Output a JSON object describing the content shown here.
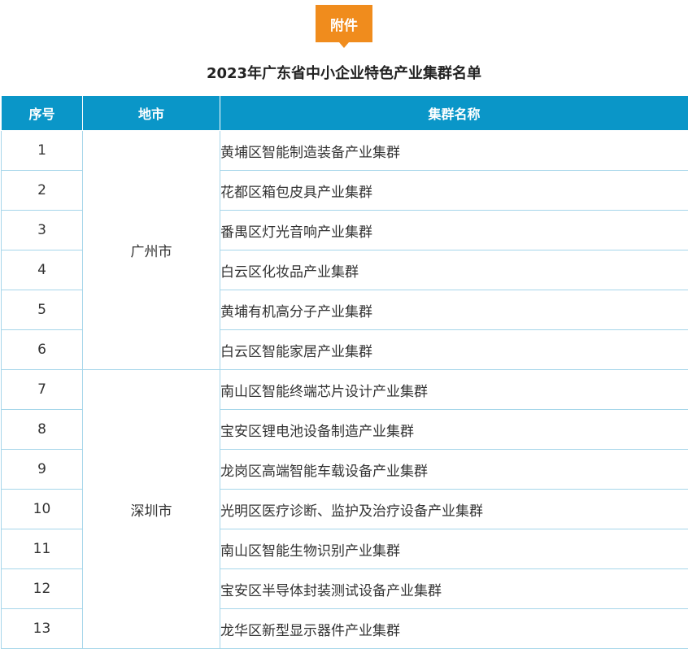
{
  "badge": "附件",
  "title": "2023年广东省中小企业特色产业集群名单",
  "table": {
    "headers": [
      "序号",
      "地市",
      "集群名称"
    ],
    "groups": [
      {
        "city": "广州市",
        "rows": [
          {
            "no": "1",
            "name": "黄埔区智能制造装备产业集群"
          },
          {
            "no": "2",
            "name": "花都区箱包皮具产业集群"
          },
          {
            "no": "3",
            "name": "番禺区灯光音响产业集群"
          },
          {
            "no": "4",
            "name": "白云区化妆品产业集群"
          },
          {
            "no": "5",
            "name": "黄埔有机高分子产业集群"
          },
          {
            "no": "6",
            "name": "白云区智能家居产业集群"
          }
        ]
      },
      {
        "city": "深圳市",
        "rows": [
          {
            "no": "7",
            "name": "南山区智能终端芯片设计产业集群"
          },
          {
            "no": "8",
            "name": "宝安区锂电池设备制造产业集群"
          },
          {
            "no": "9",
            "name": "龙岗区高端智能车载设备产业集群"
          },
          {
            "no": "10",
            "name": "光明区医疗诊断、监护及治疗设备产业集群"
          },
          {
            "no": "11",
            "name": "南山区智能生物识别产业集群"
          },
          {
            "no": "12",
            "name": "宝安区半导体封装测试设备产业集群"
          },
          {
            "no": "13",
            "name": "龙华区新型显示器件产业集群"
          }
        ]
      }
    ]
  },
  "colors": {
    "header_bg": "#0a96c8",
    "badge_bg": "#f08c1d",
    "grid_line": "#a6d6ea"
  }
}
